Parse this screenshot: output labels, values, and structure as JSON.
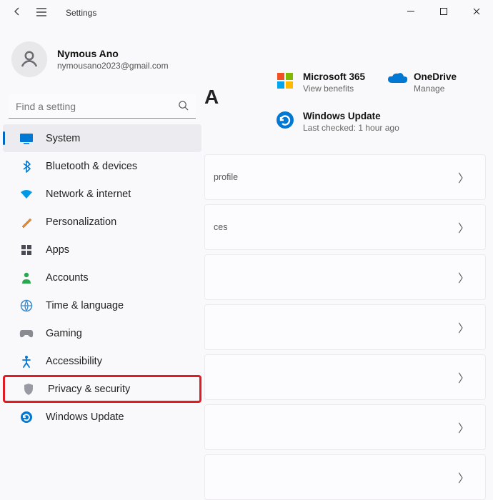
{
  "titlebar": {
    "title": "Settings"
  },
  "profile": {
    "name": "Nymous Ano",
    "email": "nymousano2023@gmail.com"
  },
  "search": {
    "placeholder": "Find a setting"
  },
  "sidebar": {
    "items": [
      {
        "label": "System"
      },
      {
        "label": "Bluetooth & devices"
      },
      {
        "label": "Network & internet"
      },
      {
        "label": "Personalization"
      },
      {
        "label": "Apps"
      },
      {
        "label": "Accounts"
      },
      {
        "label": "Time & language"
      },
      {
        "label": "Gaming"
      },
      {
        "label": "Accessibility"
      },
      {
        "label": "Privacy & security"
      },
      {
        "label": "Windows Update"
      }
    ]
  },
  "heading_fragment": "A",
  "quick": {
    "m365": {
      "title": "Microsoft 365",
      "sub": "View benefits"
    },
    "onedrive": {
      "title": "OneDrive",
      "sub": "Manage"
    },
    "update": {
      "title": "Windows Update",
      "sub": "Last checked: 1 hour ago"
    }
  },
  "cards": [
    {
      "text": "profile"
    },
    {
      "text": "ces"
    },
    {
      "text": ""
    },
    {
      "text": ""
    },
    {
      "text": ""
    },
    {
      "text": ""
    },
    {
      "text": ""
    }
  ]
}
